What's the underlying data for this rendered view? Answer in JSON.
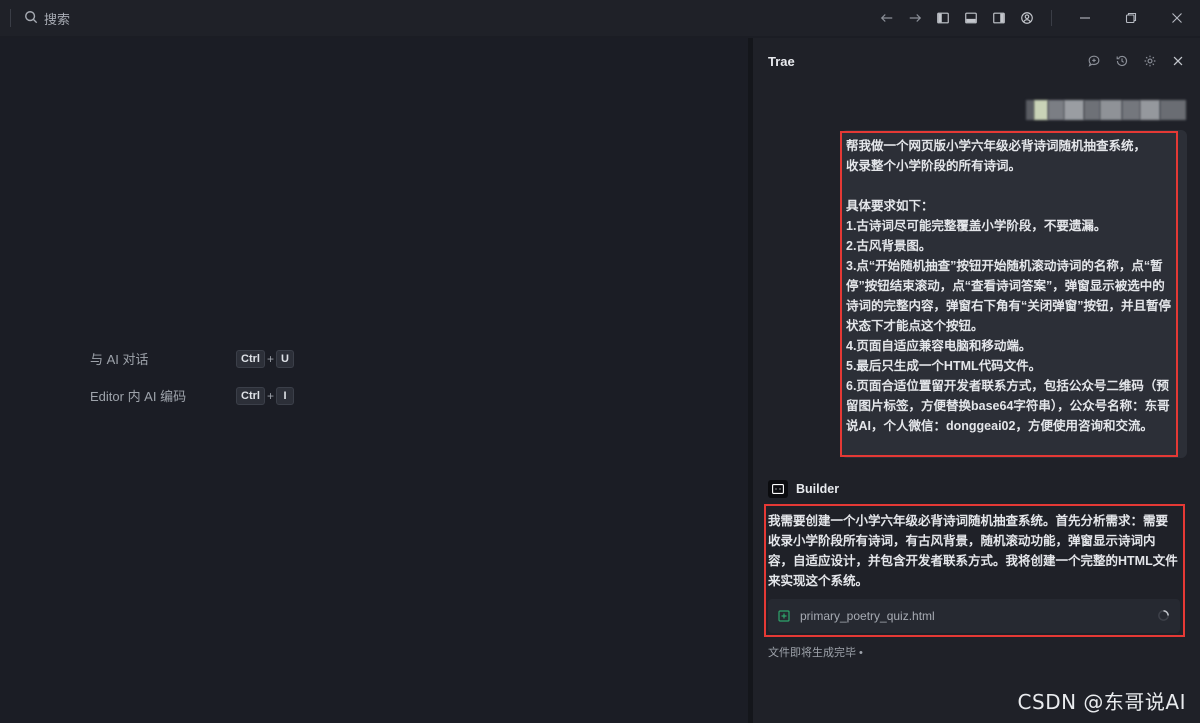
{
  "titlebar": {
    "search_placeholder": "搜索",
    "icons": [
      "back-arrow-icon",
      "forward-arrow-icon",
      "toggle-left-panel-icon",
      "toggle-bottom-panel-icon",
      "toggle-right-panel-icon",
      "account-icon"
    ],
    "window_buttons": [
      "minimize-icon",
      "restore-icon",
      "close-icon"
    ]
  },
  "editor": {
    "shortcuts": [
      {
        "label": "与 AI 对话",
        "keys": [
          "Ctrl",
          "U"
        ]
      },
      {
        "label": "Editor 内 AI 编码",
        "keys": [
          "Ctrl",
          "I"
        ]
      }
    ]
  },
  "chat": {
    "title": "Trae",
    "header_icons": [
      "new-chat-icon",
      "history-icon",
      "settings-icon",
      "close-icon"
    ],
    "user_message": "帮我做一个网页版小学六年级必背诗词随机抽查系统，\n收录整个小学阶段的所有诗词。\n\n具体要求如下：\n1.古诗词尽可能完整覆盖小学阶段，不要遗漏。\n2.古风背景图。\n3.点“开始随机抽查”按钮开始随机滚动诗词的名称，点“暂停”按钮结束滚动，点“查看诗词答案”，弹窗显示被选中的诗词的完整内容，弹窗右下角有“关闭弹窗”按钮，并且暂停状态下才能点这个按钮。\n4.页面自适应兼容电脑和移动端。\n5.最后只生成一个HTML代码文件。\n6.页面合适位置留开发者联系方式，包括公众号二维码（预留图片标签，方便替换base64字符串），公众号名称：东哥说AI，个人微信：donggeai02，方便使用咨询和交流。",
    "assistant_name": "Builder",
    "assistant_message": "我需要创建一个小学六年级必背诗词随机抽查系统。首先分析需求：需要收录小学阶段所有诗词，有古风背景，随机滚动功能，弹窗显示诗词内容，自适应设计，并包含开发者联系方式。我将创建一个完整的HTML文件来实现这个系统。",
    "file_name": "primary_poetry_quiz.html",
    "status": "文件即将生成完毕 •"
  },
  "watermark": "CSDN @东哥说AI",
  "colors": {
    "highlight_border": "#e53935",
    "file_icon": "#2ea56b"
  }
}
